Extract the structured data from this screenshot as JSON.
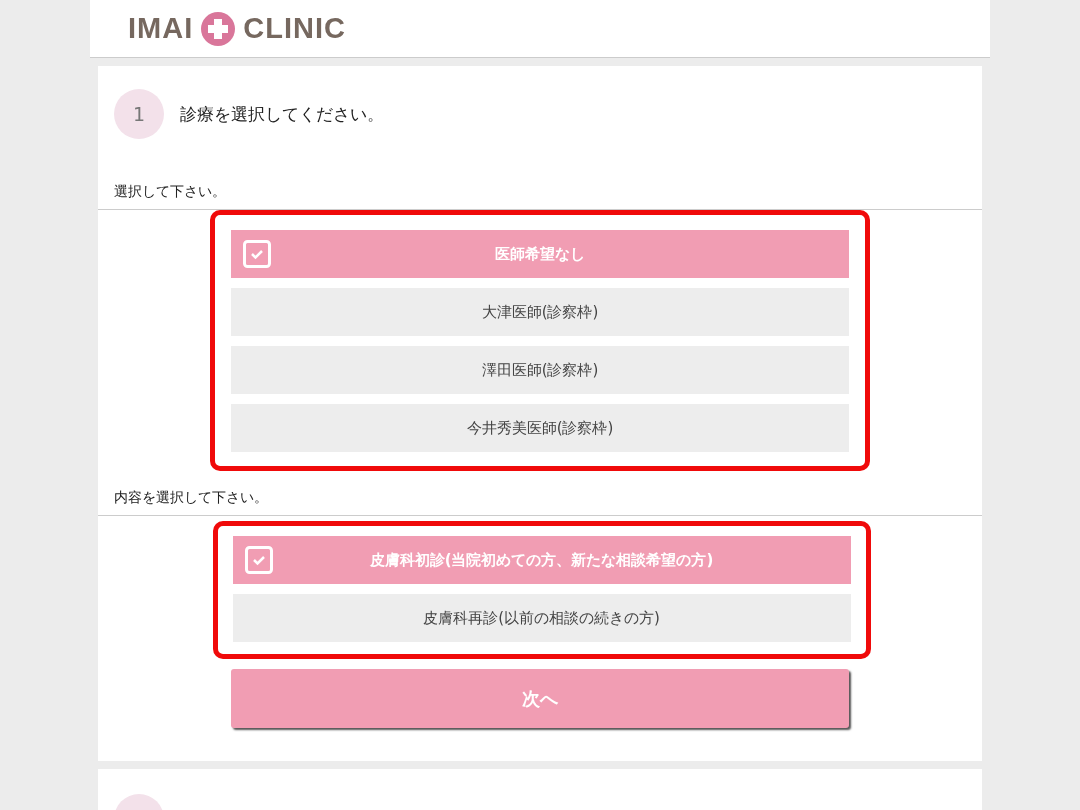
{
  "header": {
    "logo_left": "IMAI",
    "logo_right": "CLINIC"
  },
  "step": {
    "number": "1",
    "title": "診療を選択してください。"
  },
  "groups": [
    {
      "label": "選択して下さい。",
      "highlighted": true,
      "options": [
        {
          "label": "医師希望なし",
          "selected": true
        },
        {
          "label": "大津医師(診察枠)",
          "selected": false
        },
        {
          "label": "澤田医師(診察枠)",
          "selected": false
        },
        {
          "label": "今井秀美医師(診察枠)",
          "selected": false
        }
      ]
    },
    {
      "label": "内容を選択して下さい。",
      "highlighted": true,
      "options": [
        {
          "label": "皮膚科初診(当院初めての方、新たな相談希望の方)",
          "selected": true
        },
        {
          "label": "皮膚科再診(以前の相談の続きの方)",
          "selected": false
        }
      ]
    }
  ],
  "next_button": {
    "label": "次へ"
  }
}
